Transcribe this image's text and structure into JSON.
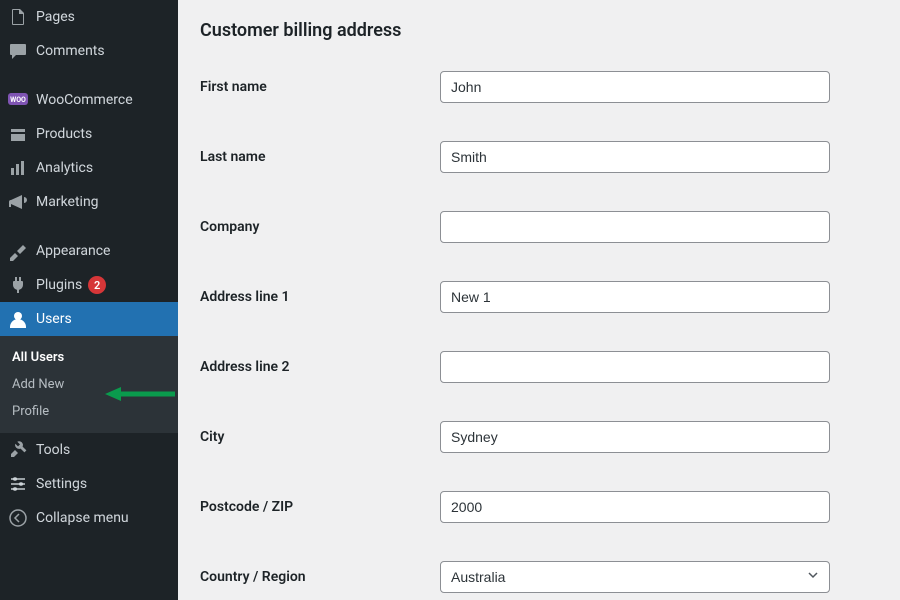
{
  "sidebar": {
    "items": [
      {
        "label": "Pages"
      },
      {
        "label": "Comments"
      },
      {
        "label": "WooCommerce"
      },
      {
        "label": "Products"
      },
      {
        "label": "Analytics"
      },
      {
        "label": "Marketing"
      },
      {
        "label": "Appearance"
      },
      {
        "label": "Plugins",
        "badge": "2"
      },
      {
        "label": "Users"
      },
      {
        "label": "Tools"
      },
      {
        "label": "Settings"
      }
    ],
    "submenu": {
      "users": [
        {
          "label": "All Users"
        },
        {
          "label": "Add New"
        },
        {
          "label": "Profile"
        }
      ]
    },
    "collapse_label": "Collapse menu"
  },
  "form": {
    "section_title": "Customer billing address",
    "fields": {
      "first_name": {
        "label": "First name",
        "value": "John"
      },
      "last_name": {
        "label": "Last name",
        "value": "Smith"
      },
      "company": {
        "label": "Company",
        "value": ""
      },
      "address1": {
        "label": "Address line 1",
        "value": "New 1"
      },
      "address2": {
        "label": "Address line 2",
        "value": ""
      },
      "city": {
        "label": "City",
        "value": "Sydney"
      },
      "postcode": {
        "label": "Postcode / ZIP",
        "value": "2000"
      },
      "country": {
        "label": "Country / Region",
        "value": "Australia"
      }
    }
  }
}
